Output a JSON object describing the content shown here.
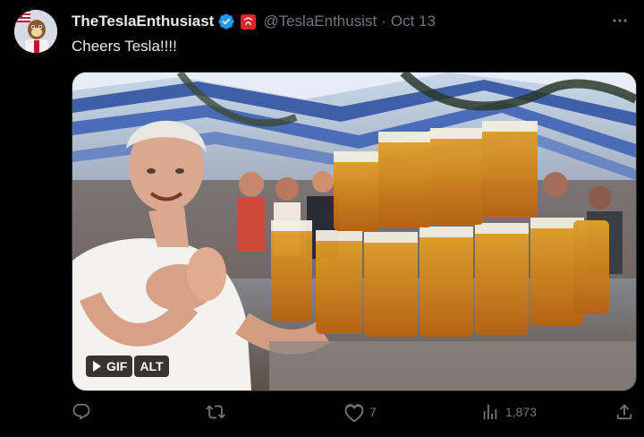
{
  "tweet": {
    "display_name": "TheTeslaEnthusiast",
    "handle": "@TeslaEnthusist",
    "separator": "·",
    "date": "Oct 13",
    "text": "Cheers Tesla!!!!"
  },
  "media": {
    "gif_label": "GIF",
    "alt_label": "ALT"
  },
  "actions": {
    "reply_count": "",
    "retweet_count": "",
    "like_count": "7",
    "view_count": "1,873"
  },
  "icons": {
    "verified": "verified-badge-icon",
    "affiliate": "affiliate-badge-icon",
    "more": "more-icon",
    "reply": "reply-icon",
    "retweet": "retweet-icon",
    "like": "heart-icon",
    "views": "views-icon",
    "share": "share-icon"
  },
  "colors": {
    "background": "#000000",
    "text": "#e7e9ea",
    "muted": "#71767b",
    "verified": "#1d9bf0",
    "affiliate": "#e0242a"
  }
}
